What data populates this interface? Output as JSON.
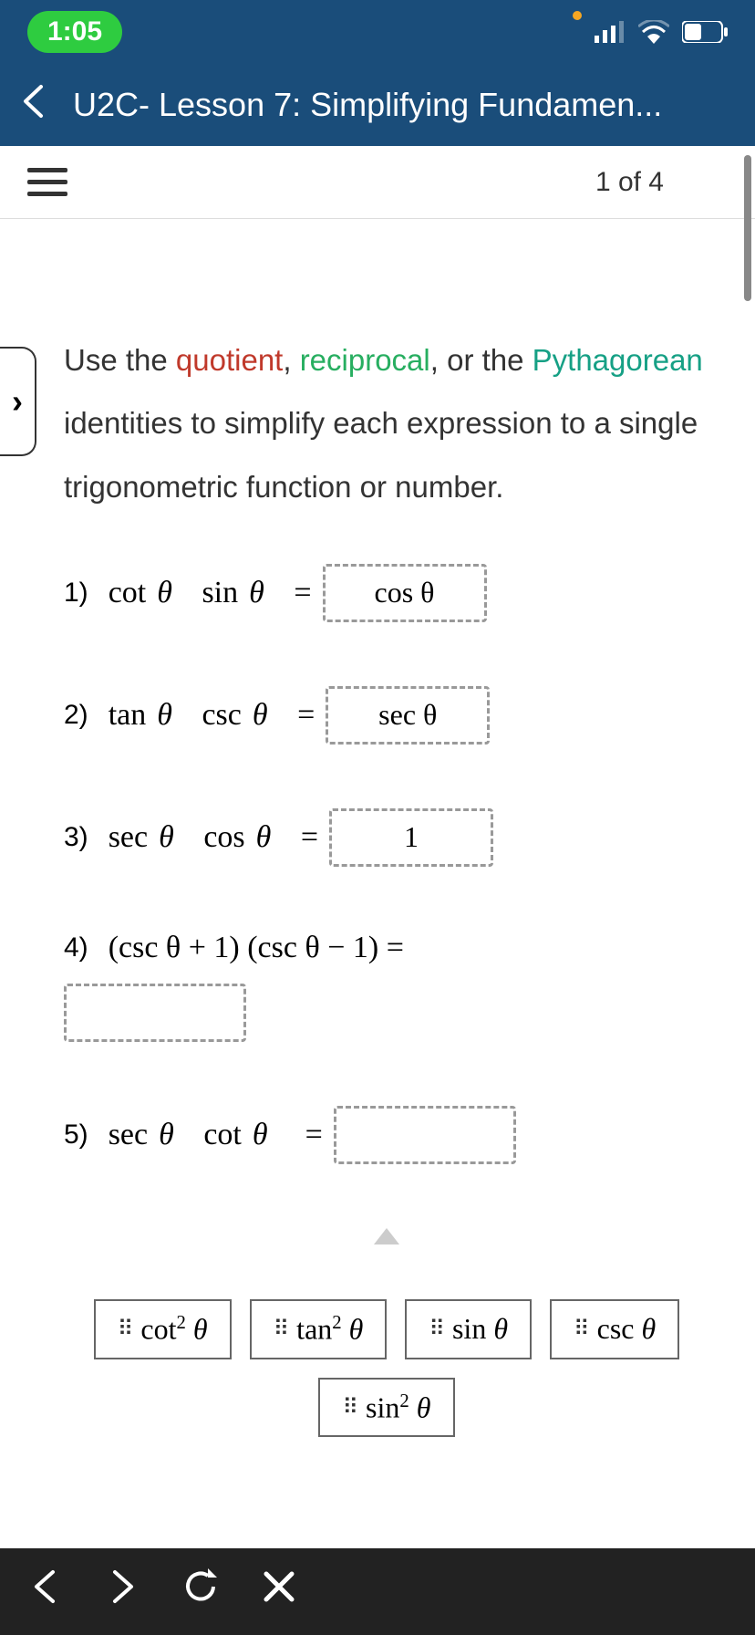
{
  "status": {
    "time": "1:05"
  },
  "header": {
    "title": "U2C- Lesson 7: Simplifying Fundamen..."
  },
  "subheader": {
    "page_count": "1 of 4"
  },
  "side_tab": {
    "glyph": "›"
  },
  "instruction": {
    "pre": "Use the ",
    "quotient": "quotient",
    "comma1": ", ",
    "reciprocal": "reciprocal",
    "comma2": ", or the ",
    "pythagorean": "Pythagorean",
    "rest": " identities to simplify each expression to a single trigonometric function or number."
  },
  "problems": {
    "p1": {
      "num": "1)",
      "expr_a": "cot",
      "expr_b": "sin",
      "eq": "=",
      "answer": "cos  θ"
    },
    "p2": {
      "num": "2)",
      "expr_a": "tan",
      "expr_b": "csc",
      "eq": "=",
      "answer": "sec  θ"
    },
    "p3": {
      "num": "3)",
      "expr_a": "sec",
      "expr_b": "cos",
      "eq": "=",
      "answer": "1"
    },
    "p4": {
      "num": "4)",
      "expr": "(csc θ   +   1) (csc θ   −   1) ="
    },
    "p5": {
      "num": "5)",
      "expr_a": "sec",
      "expr_b": "cot",
      "eq": "="
    }
  },
  "theta": "θ",
  "tiles": {
    "t1a": "cot",
    "t1b": " θ",
    "t2a": "tan",
    "t2b": " θ",
    "t3a": "sin",
    "t3b": " θ",
    "t4a": "csc",
    "t4b": " θ",
    "t5a": "sin",
    "t5b": " θ",
    "sq": "2",
    "grip": "⠿"
  }
}
